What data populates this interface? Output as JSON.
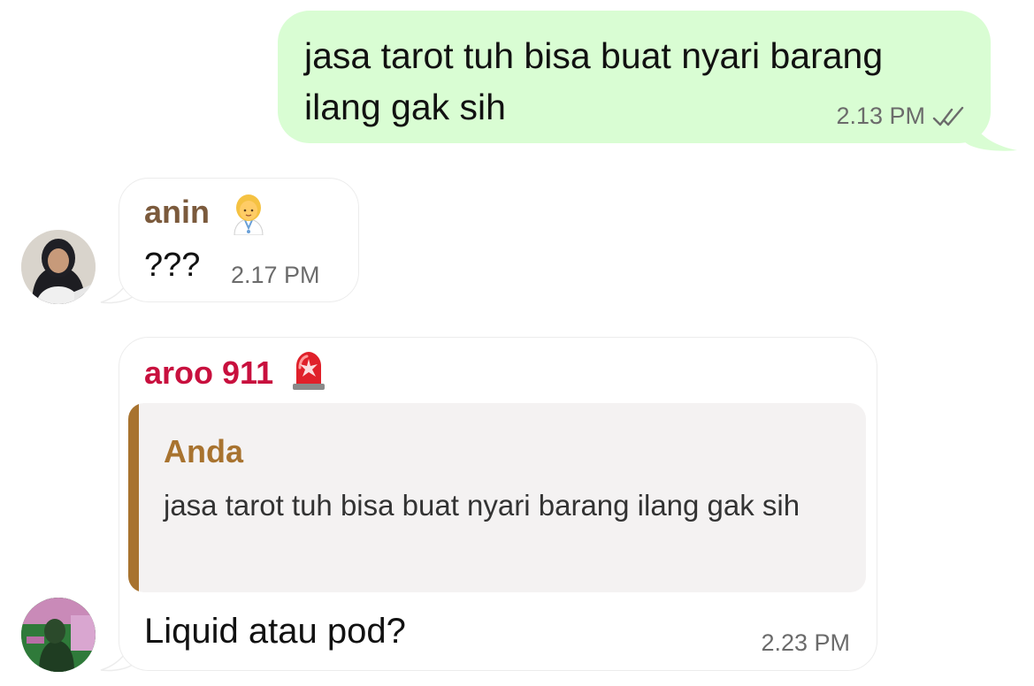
{
  "messages": {
    "outgoing": {
      "text": "jasa tarot tuh bisa buat nyari barang ilang gak sih",
      "time": "2.13 PM",
      "status_icon": "double-check-icon"
    },
    "incoming_1": {
      "sender": "anin",
      "sender_emoji": "female-health-worker-emoji",
      "text": "???",
      "time": "2.17 PM"
    },
    "incoming_2": {
      "sender": "aroo 911",
      "sender_emoji": "police-light-emoji",
      "reply_to": {
        "author": "Anda",
        "text": "jasa tarot tuh bisa buat nyari barang ilang gak sih"
      },
      "text": "Liquid atau pod?",
      "time": "2.23 PM"
    }
  },
  "colors": {
    "outgoing_bubble": "#d9fdd3",
    "sender_anin": "#7b5a3c",
    "sender_aroo": "#c8103e",
    "quote_accent": "#a8732f",
    "meta_gray": "#6b6b6b"
  }
}
